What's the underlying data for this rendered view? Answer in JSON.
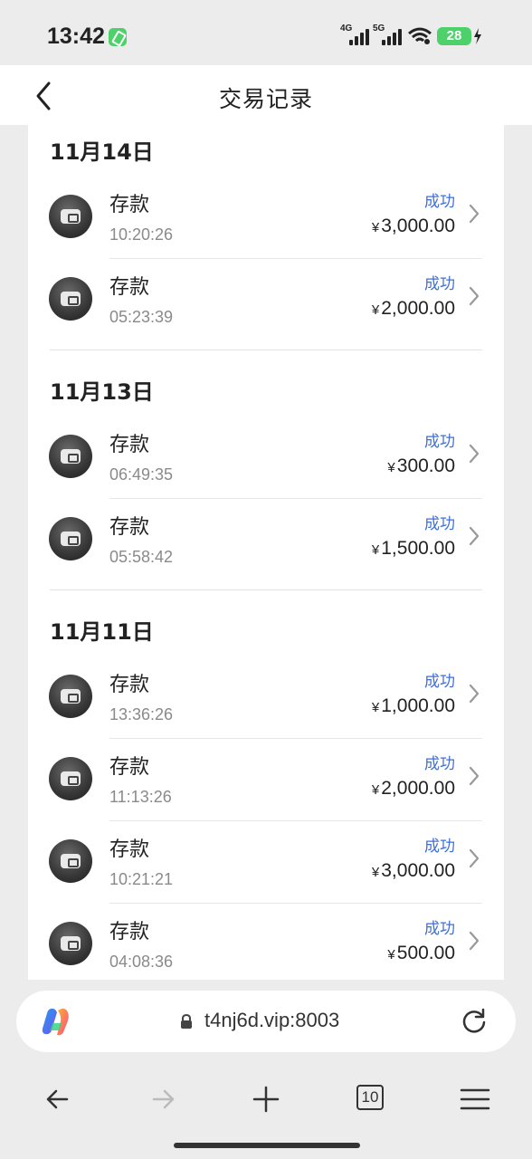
{
  "status_bar": {
    "time": "13:42",
    "net1": "4G",
    "net2": "5G",
    "battery": "28"
  },
  "header": {
    "title": "交易记录"
  },
  "groups": [
    {
      "date": "11月14日",
      "items": [
        {
          "type": "存款",
          "time": "10:20:26",
          "status": "成功",
          "currency": "¥",
          "amount": "3,000.00"
        },
        {
          "type": "存款",
          "time": "05:23:39",
          "status": "成功",
          "currency": "¥",
          "amount": "2,000.00"
        }
      ]
    },
    {
      "date": "11月13日",
      "items": [
        {
          "type": "存款",
          "time": "06:49:35",
          "status": "成功",
          "currency": "¥",
          "amount": "300.00"
        },
        {
          "type": "存款",
          "time": "05:58:42",
          "status": "成功",
          "currency": "¥",
          "amount": "1,500.00"
        }
      ]
    },
    {
      "date": "11月11日",
      "items": [
        {
          "type": "存款",
          "time": "13:36:26",
          "status": "成功",
          "currency": "¥",
          "amount": "1,000.00"
        },
        {
          "type": "存款",
          "time": "11:13:26",
          "status": "成功",
          "currency": "¥",
          "amount": "2,000.00"
        },
        {
          "type": "存款",
          "time": "10:21:21",
          "status": "成功",
          "currency": "¥",
          "amount": "3,000.00"
        },
        {
          "type": "存款",
          "time": "04:08:36",
          "status": "成功",
          "currency": "¥",
          "amount": "500.00"
        }
      ]
    }
  ],
  "browser": {
    "url": "t4nj6d.vip:8003",
    "tab_count": "10"
  },
  "colors": {
    "status_success": "#3f6fd8",
    "battery": "#4cd16b"
  }
}
